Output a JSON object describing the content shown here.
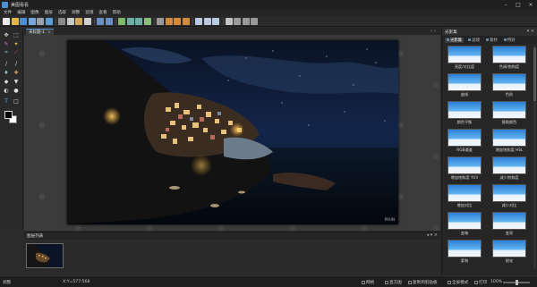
{
  "window": {
    "title": "美图看看"
  },
  "menu": [
    "文件",
    "编辑",
    "图像",
    "图层",
    "选取",
    "调整",
    "滤镜",
    "查看",
    "帮助"
  ],
  "document": {
    "tab_label": "未标题-1",
    "close_glyph": "×",
    "watermark": "PRUN"
  },
  "right_panel": {
    "title": "光影集",
    "tabs": [
      "光影集",
      "滤镜",
      "素材",
      "特效"
    ],
    "presets": [
      "亮度/对比度",
      "色调/饱和度",
      "曲线",
      "色阶",
      "颜色平衡",
      "替换颜色",
      "RGB通道",
      "增加饱和度 HSL",
      "增加饱和度 YUV",
      "减少饱和度",
      "增加对比",
      "减少对比",
      "变暗",
      "变亮",
      "柔和",
      "锐化"
    ]
  },
  "image_list": {
    "title": "图层列表"
  },
  "status": {
    "mode": "调整",
    "coords": "X:Y=577:568",
    "grid": "网格",
    "ruler": "直方图",
    "snapshot": "复制到剪贴板",
    "screen": "全屏模式",
    "fit": "打印",
    "zoom": "100%"
  },
  "colors": {
    "accent": "#5b9bd5",
    "fg_swatch": "#000000",
    "bg_swatch": "#ffffff"
  }
}
